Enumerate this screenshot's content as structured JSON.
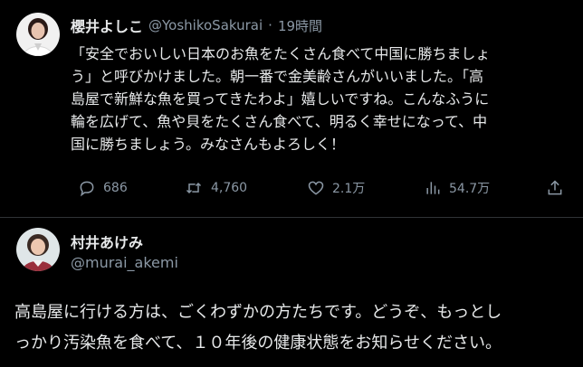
{
  "tweet": {
    "author_name": "櫻井よしこ",
    "author_handle": "@YoshikoSakurai",
    "separator": "·",
    "time": "19時間",
    "text_lines": [
      "「安全でおいしい日本のお魚をたくさん食べて中国に勝ちましょ",
      "う」と呼びかけました。朝一番で金美齢さんがいいました。「高",
      "島屋で新鮮な魚を買ってきたわよ」嬉しいですね。こんなふうに",
      "輪を広げて、魚や貝をたくさん食べて、明るく幸せになって、中",
      "国に勝ちましょう。みなさんもよろしく！"
    ],
    "actions": {
      "reply_count": "686",
      "retweet_count": "4,760",
      "like_count": "2.1万",
      "view_count": "54.7万"
    }
  },
  "reply": {
    "author_name": "村井あけみ",
    "author_handle": "@murai_akemi",
    "text_lines": [
      "高島屋に行ける方は、ごくわずかの方たちです。どうぞ、もっとし",
      "っかり汚染魚を食べて、１０年後の健康状態をお知らせください。"
    ]
  }
}
